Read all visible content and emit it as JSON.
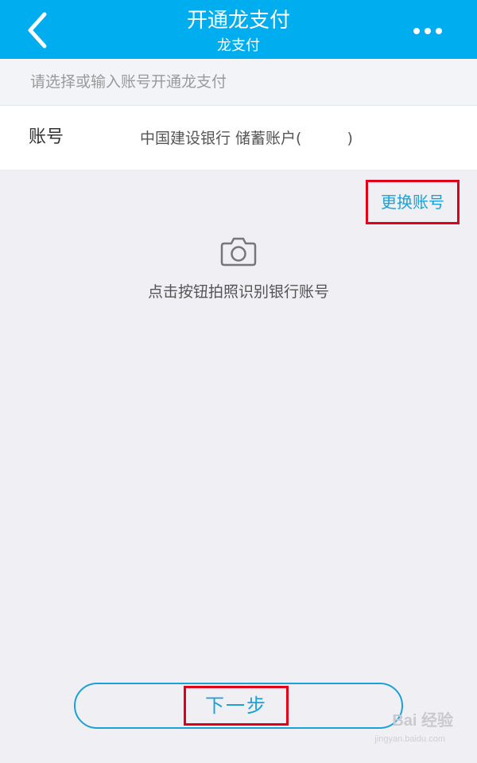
{
  "header": {
    "title": "开通龙支付",
    "subtitle": "龙支付",
    "back_icon": "chevron-left-icon",
    "more_icon": "more-dots-icon",
    "background_color": "#00adef"
  },
  "hint": {
    "text": "请选择或输入账号开通龙支付"
  },
  "account": {
    "label": "账号",
    "value": "中国建设银行 储蓄账户(　　　)"
  },
  "change_account": {
    "label": "更换账号"
  },
  "camera": {
    "icon": "camera-icon",
    "tip": "点击按钮拍照识别银行账号"
  },
  "next": {
    "label": "下一步"
  },
  "watermark": {
    "text": "Bai 经验",
    "sub": "jingyan.baidu.com"
  },
  "colors": {
    "accent": "#1aa2d8",
    "highlight_box": "#e0001a",
    "page_background": "#efeff4"
  }
}
